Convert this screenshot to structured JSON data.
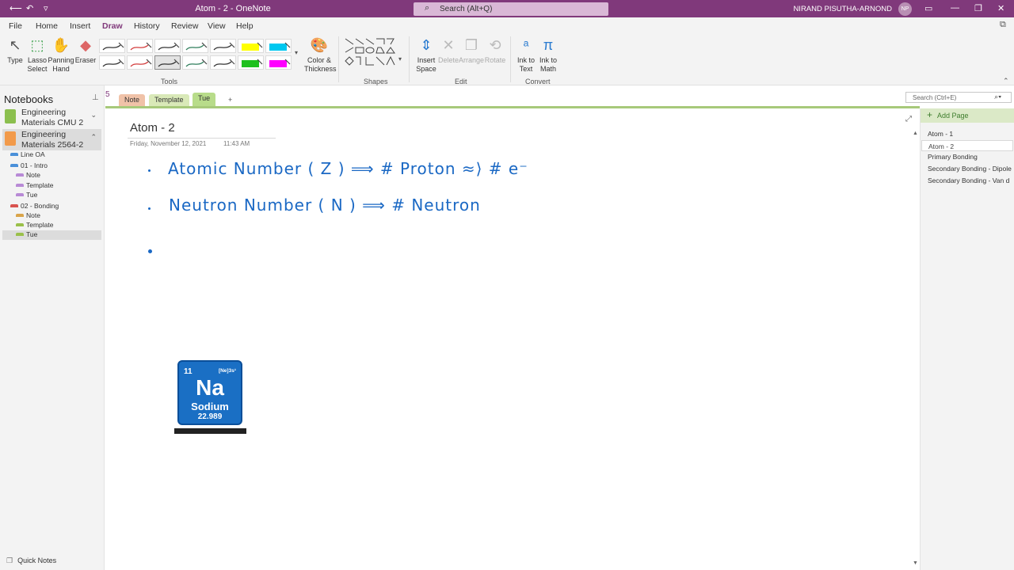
{
  "titlebar": {
    "doc_title": "Atom - 2  -  OneNote",
    "search_label": "Search (Alt+Q)",
    "user_name": "NIRAND PISUTHA-ARNOND",
    "user_initials": "NP"
  },
  "menu": {
    "tabs": [
      {
        "label": "File"
      },
      {
        "label": "Home"
      },
      {
        "label": "Insert"
      },
      {
        "label": "Draw"
      },
      {
        "label": "History"
      },
      {
        "label": "Review"
      },
      {
        "label": "View"
      },
      {
        "label": "Help"
      }
    ],
    "active_tab": "Draw"
  },
  "ribbon": {
    "tools": {
      "type": "Type",
      "lasso_1": "Lasso",
      "lasso_2": "Select",
      "pan_1": "Panning",
      "pan_2": "Hand",
      "eraser": "Eraser",
      "color_1": "Color &",
      "color_2": "Thickness",
      "group": "Tools"
    },
    "shapes_group": "Shapes",
    "edit": {
      "insert_1": "Insert",
      "insert_2": "Space",
      "delete": "Delete",
      "arrange": "Arrange",
      "rotate": "Rotate",
      "group": "Edit"
    },
    "convert": {
      "ink_text_1": "Ink to",
      "ink_text_2": "Text",
      "ink_math_1": "Ink to",
      "ink_math_2": "Math",
      "group": "Convert"
    },
    "pen_colors": [
      "#333333",
      "#d33c3c",
      "#333333",
      "#2e7d5b",
      "#333333",
      "#ffff00",
      "#00c8f0",
      "#333333",
      "#d33c3c",
      "#333333",
      "#2e7d5b",
      "#333333",
      "#1ec01e",
      "#ff00ff"
    ]
  },
  "notebooks": {
    "title": "Notebooks",
    "items": [
      {
        "line1": "Engineering",
        "line2": "Materials CMU 2",
        "color": "#8bbf4e"
      },
      {
        "line1": "Engineering",
        "line2": "Materials 2564-2",
        "color": "#f29a4a"
      }
    ],
    "sections": [
      {
        "label": "Line OA",
        "color": "#4a90d9"
      },
      {
        "label": "01 - Intro",
        "color": "#4a90d9"
      },
      {
        "label": "Note",
        "color": "#b88ad6"
      },
      {
        "label": "Template",
        "color": "#b88ad6"
      },
      {
        "label": "Tue",
        "color": "#b88ad6"
      },
      {
        "label": "02 - Bonding",
        "color": "#d9534f"
      },
      {
        "label": "Note",
        "color": "#d9a44a"
      },
      {
        "label": "Template",
        "color": "#9ac04a"
      },
      {
        "label": "Tue",
        "color": "#9ac04a"
      }
    ],
    "quick_notes": "Quick Notes"
  },
  "section_tabs": [
    {
      "label": "Note",
      "color": "#f0c2a8"
    },
    {
      "label": "Template",
      "color": "#d9e9b8"
    },
    {
      "label": "Tue",
      "color": "#b8dc8a"
    }
  ],
  "section_count": "5",
  "add_tab": "+",
  "page": {
    "title": "Atom - 2",
    "date": "Friday, November 12, 2021",
    "time": "11:43 AM",
    "ink_line1": "Atomic  Number  ( Z )  ⟹  #  Proton  ≈⟩  # e⁻",
    "ink_line2": "Neutron  Number  ( N )  ⟹  #   Neutron"
  },
  "element_card": {
    "number": "11",
    "config": "[Ne]3s¹",
    "symbol": "Na",
    "name": "Sodium",
    "mass": "22.989"
  },
  "pagelist": {
    "search_placeholder": "Search (Ctrl+E)",
    "add_page": "Add Page",
    "pages": [
      {
        "label": "Atom - 1"
      },
      {
        "label": "Atom - 2"
      },
      {
        "label": "Primary Bonding"
      },
      {
        "label": "Secondary Bonding - Dipole"
      },
      {
        "label": "Secondary Bonding - Van d"
      }
    ]
  }
}
